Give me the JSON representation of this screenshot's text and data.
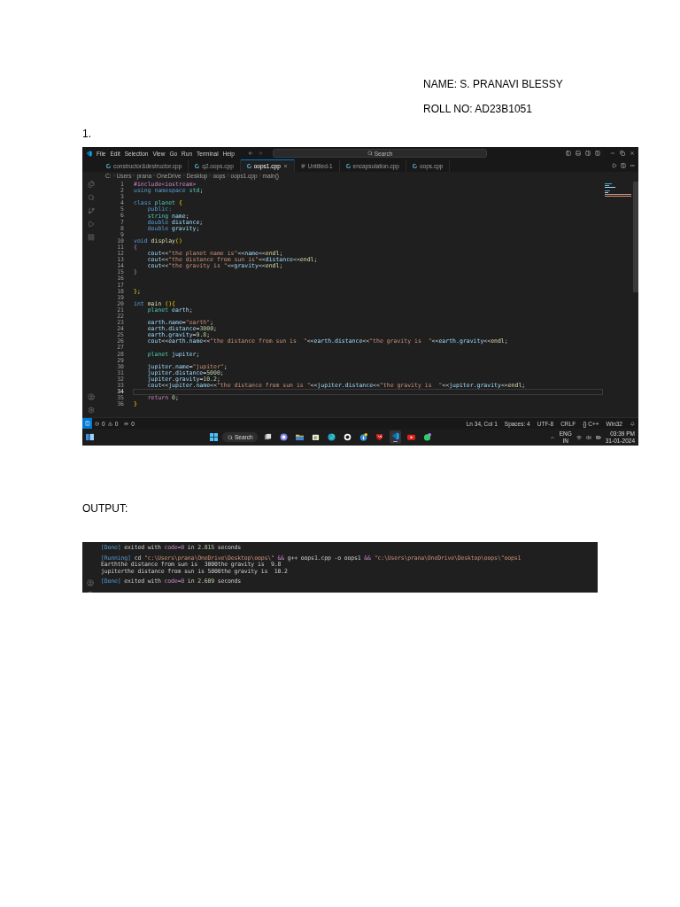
{
  "document": {
    "name_line": "NAME: S. PRANAVI BLESSY",
    "roll_line": "ROLL NO: AD23B1051",
    "item_number": "1.",
    "output_heading": "OUTPUT:"
  },
  "editor_window": {
    "menu": [
      "File",
      "Edit",
      "Selection",
      "View",
      "Go",
      "Run",
      "Terminal",
      "Help"
    ],
    "search": "Search",
    "tabs": [
      {
        "label": "constructor&destructor.cpp",
        "kind": "cpp",
        "selected": false
      },
      {
        "label": "q2.oops.cpp",
        "kind": "cpp",
        "selected": false
      },
      {
        "label": "oops1.cpp",
        "kind": "cpp",
        "selected": true
      },
      {
        "label": "Untitled-1",
        "kind": "text",
        "selected": false
      },
      {
        "label": "encapsulation.cpp",
        "kind": "cpp",
        "selected": false
      },
      {
        "label": "oops.cpp",
        "kind": "cpp",
        "selected": false
      }
    ],
    "breadcrumb": [
      "C:",
      "Users",
      "prana",
      "OneDrive",
      "Desktop",
      "oops",
      "oops1.cpp",
      "main()"
    ],
    "code": [
      {
        "n": "1",
        "current": false,
        "tokens": [
          {
            "text": "#include<iostream>",
            "kind": "macro"
          }
        ]
      },
      {
        "n": "2",
        "current": false,
        "tokens": [
          {
            "text": "using namespace ",
            "kind": "kw"
          },
          {
            "text": "std",
            "kind": "type"
          },
          {
            "text": ";",
            "kind": "p"
          }
        ]
      },
      {
        "n": "3",
        "current": false
      },
      {
        "n": "4",
        "current": false,
        "tokens": [
          {
            "text": "class ",
            "kind": "kw"
          },
          {
            "text": "planet ",
            "kind": "type"
          },
          {
            "text": "{",
            "kind": "br"
          }
        ]
      },
      {
        "n": "5",
        "current": false,
        "tokens": [
          {
            "text": "    public:",
            "kind": "kw"
          }
        ]
      },
      {
        "n": "6",
        "current": false,
        "tokens": [
          {
            "text": "    string ",
            "kind": "type"
          },
          {
            "text": "name",
            "kind": "var"
          },
          {
            "text": ";",
            "kind": "p"
          }
        ]
      },
      {
        "n": "7",
        "current": false,
        "tokens": [
          {
            "text": "    double ",
            "kind": "kw"
          },
          {
            "text": "distance",
            "kind": "var"
          },
          {
            "text": ";",
            "kind": "p"
          }
        ]
      },
      {
        "n": "8",
        "current": false,
        "tokens": [
          {
            "text": "    double ",
            "kind": "kw"
          },
          {
            "text": "gravity",
            "kind": "var"
          },
          {
            "text": ";",
            "kind": "p"
          }
        ]
      },
      {
        "n": "9",
        "current": false
      },
      {
        "n": "10",
        "current": false,
        "tokens": [
          {
            "text": "void ",
            "kind": "kw"
          },
          {
            "text": "display",
            "kind": "fn"
          },
          {
            "text": "()",
            "kind": "br"
          }
        ]
      },
      {
        "n": "11",
        "current": false,
        "tokens": [
          {
            "text": "{",
            "kind": "macro"
          }
        ]
      },
      {
        "n": "12",
        "current": false,
        "tokens": [
          {
            "text": "    cout",
            "kind": "var"
          },
          {
            "text": "<<",
            "kind": "p"
          },
          {
            "text": "\"the planet name is\"",
            "kind": "str"
          },
          {
            "text": "<<",
            "kind": "p"
          },
          {
            "text": "name",
            "kind": "var"
          },
          {
            "text": "<<",
            "kind": "p"
          },
          {
            "text": "endl",
            "kind": "fn"
          },
          {
            "text": ";",
            "kind": "p"
          }
        ]
      },
      {
        "n": "13",
        "current": false,
        "tokens": [
          {
            "text": "    cout",
            "kind": "var"
          },
          {
            "text": "<<",
            "kind": "p"
          },
          {
            "text": "\"the distance from sun is\"",
            "kind": "str"
          },
          {
            "text": "<<",
            "kind": "p"
          },
          {
            "text": "distance",
            "kind": "var"
          },
          {
            "text": "<<",
            "kind": "p"
          },
          {
            "text": "endl",
            "kind": "fn"
          },
          {
            "text": ";",
            "kind": "p"
          }
        ]
      },
      {
        "n": "14",
        "current": false,
        "tokens": [
          {
            "text": "    cout",
            "kind": "var"
          },
          {
            "text": "<<",
            "kind": "p"
          },
          {
            "text": "\"the gravity is \"",
            "kind": "str"
          },
          {
            "text": "<<",
            "kind": "p"
          },
          {
            "text": "gravity",
            "kind": "var"
          },
          {
            "text": "<<",
            "kind": "p"
          },
          {
            "text": "endl",
            "kind": "fn"
          },
          {
            "text": ";",
            "kind": "p"
          }
        ]
      },
      {
        "n": "15",
        "current": false,
        "tokens": [
          {
            "text": "}",
            "kind": "macro"
          }
        ]
      },
      {
        "n": "16",
        "current": false
      },
      {
        "n": "17",
        "current": false
      },
      {
        "n": "18",
        "current": false,
        "tokens": [
          {
            "text": "}",
            "kind": "br"
          },
          {
            "text": ";",
            "kind": "p"
          }
        ]
      },
      {
        "n": "19",
        "current": false
      },
      {
        "n": "20",
        "current": false,
        "tokens": [
          {
            "text": "int ",
            "kind": "kw"
          },
          {
            "text": "main ",
            "kind": "fn"
          },
          {
            "text": "(){",
            "kind": "br"
          }
        ]
      },
      {
        "n": "21",
        "current": false,
        "tokens": [
          {
            "text": "    planet ",
            "kind": "type"
          },
          {
            "text": "earth",
            "kind": "var"
          },
          {
            "text": ";",
            "kind": "p"
          }
        ]
      },
      {
        "n": "22",
        "current": false
      },
      {
        "n": "23",
        "current": false,
        "tokens": [
          {
            "text": "    earth",
            "kind": "var"
          },
          {
            "text": ".",
            "kind": "p"
          },
          {
            "text": "name",
            "kind": "var"
          },
          {
            "text": "=",
            "kind": "p"
          },
          {
            "text": "\"earth\"",
            "kind": "str"
          },
          {
            "text": ";",
            "kind": "p"
          }
        ]
      },
      {
        "n": "24",
        "current": false,
        "tokens": [
          {
            "text": "    earth",
            "kind": "var"
          },
          {
            "text": ".",
            "kind": "p"
          },
          {
            "text": "distance",
            "kind": "var"
          },
          {
            "text": "=",
            "kind": "p"
          },
          {
            "text": "3000",
            "kind": "num"
          },
          {
            "text": ";",
            "kind": "p"
          }
        ]
      },
      {
        "n": "25",
        "current": false,
        "tokens": [
          {
            "text": "    earth",
            "kind": "var"
          },
          {
            "text": ".",
            "kind": "p"
          },
          {
            "text": "gravity",
            "kind": "var"
          },
          {
            "text": "=",
            "kind": "p"
          },
          {
            "text": "9.8",
            "kind": "num"
          },
          {
            "text": ";",
            "kind": "p"
          }
        ]
      },
      {
        "n": "26",
        "current": false,
        "tokens": [
          {
            "text": "    cout",
            "kind": "var"
          },
          {
            "text": "<<",
            "kind": "p"
          },
          {
            "text": "earth.name",
            "kind": "var"
          },
          {
            "text": "<<",
            "kind": "p"
          },
          {
            "text": "\"the distance from sun is  \"",
            "kind": "str"
          },
          {
            "text": "<<",
            "kind": "p"
          },
          {
            "text": "earth.distance",
            "kind": "var"
          },
          {
            "text": "<<",
            "kind": "p"
          },
          {
            "text": "\"the gravity is  \"",
            "kind": "str"
          },
          {
            "text": "<<",
            "kind": "p"
          },
          {
            "text": "earth.gravity",
            "kind": "var"
          },
          {
            "text": "<<",
            "kind": "p"
          },
          {
            "text": "endl",
            "kind": "fn"
          },
          {
            "text": ";",
            "kind": "p"
          }
        ]
      },
      {
        "n": "27",
        "current": false
      },
      {
        "n": "28",
        "current": false,
        "tokens": [
          {
            "text": "    planet ",
            "kind": "type"
          },
          {
            "text": "jupiter",
            "kind": "var"
          },
          {
            "text": ";",
            "kind": "p"
          }
        ]
      },
      {
        "n": "29",
        "current": false
      },
      {
        "n": "30",
        "current": false,
        "tokens": [
          {
            "text": "    jupiter",
            "kind": "var"
          },
          {
            "text": ".",
            "kind": "p"
          },
          {
            "text": "name",
            "kind": "var"
          },
          {
            "text": "=",
            "kind": "p"
          },
          {
            "text": "\"jupiter\"",
            "kind": "str"
          },
          {
            "text": ";",
            "kind": "p"
          }
        ]
      },
      {
        "n": "31",
        "current": false,
        "tokens": [
          {
            "text": "    jupiter",
            "kind": "var"
          },
          {
            "text": ".",
            "kind": "p"
          },
          {
            "text": "distance",
            "kind": "var"
          },
          {
            "text": "=",
            "kind": "p"
          },
          {
            "text": "5000",
            "kind": "num"
          },
          {
            "text": ";",
            "kind": "p"
          }
        ]
      },
      {
        "n": "32",
        "current": false,
        "tokens": [
          {
            "text": "    jupiter",
            "kind": "var"
          },
          {
            "text": ".",
            "kind": "p"
          },
          {
            "text": "gravity",
            "kind": "var"
          },
          {
            "text": "=",
            "kind": "p"
          },
          {
            "text": "10.2",
            "kind": "num"
          },
          {
            "text": ";",
            "kind": "p"
          }
        ]
      },
      {
        "n": "33",
        "current": false,
        "tokens": [
          {
            "text": "    cout",
            "kind": "var"
          },
          {
            "text": "<<",
            "kind": "p"
          },
          {
            "text": "jupiter.name",
            "kind": "var"
          },
          {
            "text": "<<",
            "kind": "p"
          },
          {
            "text": "\"the distance from sun is \"",
            "kind": "str"
          },
          {
            "text": "<<",
            "kind": "p"
          },
          {
            "text": "jupiter.distance",
            "kind": "var"
          },
          {
            "text": "<<",
            "kind": "p"
          },
          {
            "text": "\"the gravity is  \"",
            "kind": "str"
          },
          {
            "text": "<<",
            "kind": "p"
          },
          {
            "text": "jupiter.gravity",
            "kind": "var"
          },
          {
            "text": "<<",
            "kind": "p"
          },
          {
            "text": "endl",
            "kind": "fn"
          },
          {
            "text": ";",
            "kind": "p"
          }
        ]
      },
      {
        "n": "34",
        "current": true
      },
      {
        "n": "35",
        "current": false,
        "tokens": [
          {
            "text": "    return ",
            "kind": "macro"
          },
          {
            "text": "0",
            "kind": "num"
          },
          {
            "text": ";",
            "kind": "p"
          }
        ]
      },
      {
        "n": "36",
        "current": false,
        "tokens": [
          {
            "text": "}",
            "kind": "br"
          }
        ]
      }
    ],
    "status_bar": {
      "errors": "0",
      "warnings": "0",
      "ports": "0",
      "items": [
        "Ln 34, Col 1",
        "Spaces: 4",
        "UTF-8",
        "CRLF",
        "{} C++",
        "Win32"
      ]
    },
    "taskbar": {
      "search": "Search",
      "apps": [
        {
          "kind": "taskview",
          "active": false
        },
        {
          "kind": "chat",
          "active": false
        },
        {
          "kind": "folder",
          "active": false
        },
        {
          "kind": "store",
          "active": false
        },
        {
          "kind": "edge",
          "active": false
        },
        {
          "kind": "ring",
          "active": false
        },
        {
          "kind": "info",
          "active": false
        },
        {
          "kind": "shield",
          "active": false
        },
        {
          "kind": "code",
          "active": true
        },
        {
          "kind": "video",
          "active": false
        },
        {
          "kind": "phone",
          "active": false
        }
      ],
      "language": "ENG",
      "region": "IN",
      "time": "03:39 PM",
      "date": "31-01-2024"
    }
  },
  "output_panel": {
    "groups": [
      [
        [
          {
            "text": "[Done] ",
            "kind": "tag"
          },
          {
            "text": "exited with ",
            "kind": "plain"
          },
          {
            "text": "code=0",
            "kind": "key"
          },
          {
            "text": " in ",
            "kind": "plain"
          },
          {
            "text": "2.815",
            "kind": "num"
          },
          {
            "text": " seconds",
            "kind": "plain"
          }
        ]
      ],
      [
        [
          {
            "text": "[Running] ",
            "kind": "tag"
          },
          {
            "text": "cd ",
            "kind": "plain"
          },
          {
            "text": "\"c:\\Users\\prana\\OneDrive\\Desktop\\oops\\\"",
            "kind": "str"
          },
          {
            "text": " && ",
            "kind": "key"
          },
          {
            "text": "g++ oops1.cpp -o oops1",
            "kind": "plain"
          },
          {
            "text": " && ",
            "kind": "key"
          },
          {
            "text": "\"c:\\Users\\prana\\OneDrive\\Desktop\\oops\\\"oops1",
            "kind": "str"
          }
        ],
        [
          {
            "text": "Earththe distance from sun is  3000the gravity is  9.8",
            "kind": "plain"
          }
        ],
        [
          {
            "text": "jupiterthe distance from sun is 5000the gravity is  10.2",
            "kind": "plain"
          }
        ]
      ],
      [
        [
          {
            "text": "[Done] ",
            "kind": "tag"
          },
          {
            "text": "exited with ",
            "kind": "plain"
          },
          {
            "text": "code=0",
            "kind": "key"
          },
          {
            "text": " in ",
            "kind": "plain"
          },
          {
            "text": "2.609",
            "kind": "num"
          },
          {
            "text": " seconds",
            "kind": "plain"
          }
        ]
      ]
    ]
  }
}
